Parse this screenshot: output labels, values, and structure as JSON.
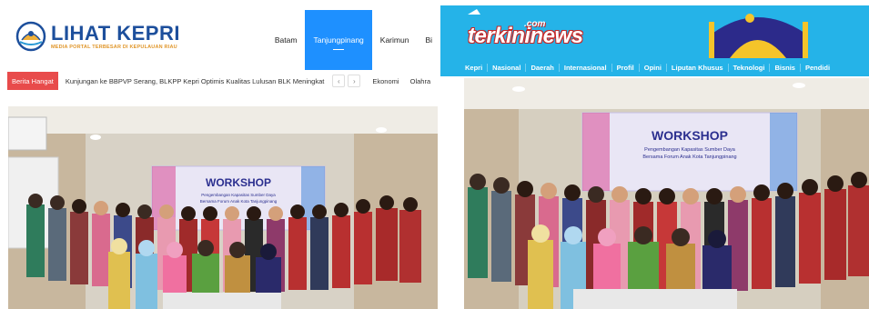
{
  "left_site": {
    "logo": {
      "title": "LIHAT KEPRI",
      "subtitle": "MEDIA PORTAL TERBESAR DI KEPULAUAN RIAU"
    },
    "nav": [
      {
        "label": "Batam",
        "active": false
      },
      {
        "label": "Tanjungpinang",
        "active": true
      },
      {
        "label": "Karimun",
        "active": false
      },
      {
        "label": "Bi",
        "active": false
      }
    ],
    "ticker": {
      "label": "Berita Hangat",
      "headline": "Kunjungan ke BBPVP Serang, BLKPP Kepri Optimis Kualitas Lulusan BLK Meningkat",
      "prev": "‹",
      "next": "›",
      "categories": [
        "Ekonomi",
        "Olahra"
      ]
    },
    "photo": {
      "banner_title": "WORKSHOP",
      "banner_line1": "Pengembangan Kapasitas Sumber Daya",
      "banner_line2": "Bersama Forum Anak Kota Tanjungpinang"
    }
  },
  "right_site": {
    "brand": "terkininews",
    "brand_suffix": ".com",
    "nav": [
      "Kepri",
      "Nasional",
      "Daerah",
      "Internasional",
      "Profil",
      "Opini",
      "Liputan Khusus",
      "Teknologi",
      "Bisnis",
      "Pendidi"
    ],
    "photo": {
      "banner_title": "WORKSHOP",
      "banner_line1": "Pengembangan Kapasitas Sumber Daya",
      "banner_line2": "Bersama Forum Anak Kota Tanjungpinang"
    }
  },
  "colors": {
    "left_accent": "#1e90ff",
    "ticker_red": "#e84b4b",
    "right_header": "#25b3e8",
    "logo_blue": "#1d4f9c"
  }
}
